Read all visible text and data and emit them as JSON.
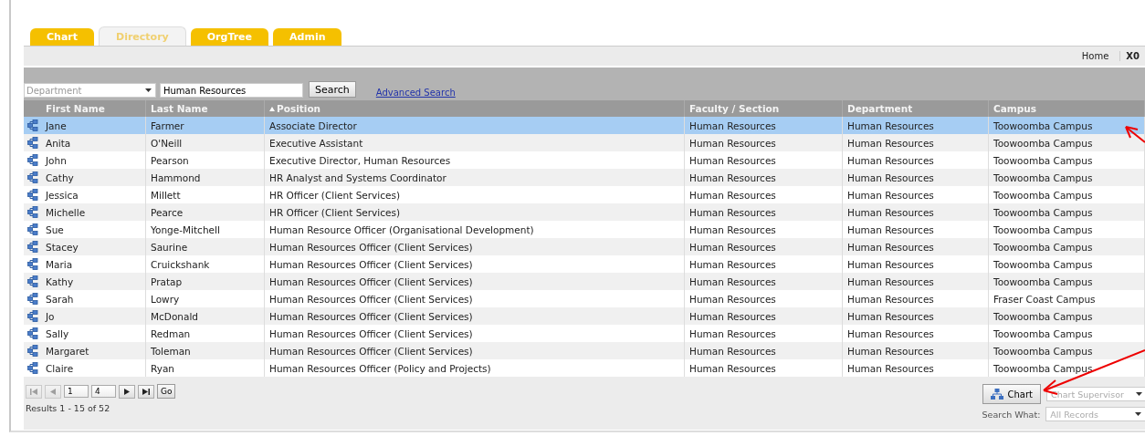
{
  "tabs": [
    {
      "label": "Chart",
      "selected": false
    },
    {
      "label": "Directory",
      "selected": true
    },
    {
      "label": "OrgTree",
      "selected": false
    },
    {
      "label": "Admin",
      "selected": false
    }
  ],
  "toolbar": {
    "links": [
      "Home",
      "X0"
    ]
  },
  "search": {
    "field_select": "Department",
    "query": "Human Resources",
    "button": "Search",
    "advanced_link": "Advanced Search"
  },
  "table": {
    "columns": [
      {
        "label": "First Name",
        "sorted": false
      },
      {
        "label": "Last Name",
        "sorted": false
      },
      {
        "label": "Position",
        "sorted": true
      },
      {
        "label": "Faculty / Section",
        "sorted": false
      },
      {
        "label": "Department",
        "sorted": false
      },
      {
        "label": "Campus",
        "sorted": false
      }
    ],
    "rows": [
      {
        "cells": [
          "Jane",
          "Farmer",
          "Associate Director",
          "Human Resources",
          "Human Resources",
          "Toowoomba Campus"
        ],
        "selected": true
      },
      {
        "cells": [
          "Anita",
          "O'Neill",
          "Executive Assistant",
          "Human Resources",
          "Human Resources",
          "Toowoomba Campus"
        ],
        "selected": false
      },
      {
        "cells": [
          "John",
          "Pearson",
          "Executive Director, Human Resources",
          "Human Resources",
          "Human Resources",
          "Toowoomba Campus"
        ],
        "selected": false
      },
      {
        "cells": [
          "Cathy",
          "Hammond",
          "HR Analyst and Systems Coordinator",
          "Human Resources",
          "Human Resources",
          "Toowoomba Campus"
        ],
        "selected": false
      },
      {
        "cells": [
          "Jessica",
          "Millett",
          "HR Officer (Client Services)",
          "Human Resources",
          "Human Resources",
          "Toowoomba Campus"
        ],
        "selected": false
      },
      {
        "cells": [
          "Michelle",
          "Pearce",
          "HR Officer (Client Services)",
          "Human Resources",
          "Human Resources",
          "Toowoomba Campus"
        ],
        "selected": false
      },
      {
        "cells": [
          "Sue",
          "Yonge-Mitchell",
          "Human Resource Officer (Organisational Development)",
          "Human Resources",
          "Human Resources",
          "Toowoomba Campus"
        ],
        "selected": false
      },
      {
        "cells": [
          "Stacey",
          "Saurine",
          "Human Resources Officer (Client Services)",
          "Human Resources",
          "Human Resources",
          "Toowoomba Campus"
        ],
        "selected": false
      },
      {
        "cells": [
          "Maria",
          "Cruickshank",
          "Human Resources Officer (Client Services)",
          "Human Resources",
          "Human Resources",
          "Toowoomba Campus"
        ],
        "selected": false
      },
      {
        "cells": [
          "Kathy",
          "Pratap",
          "Human Resources Officer (Client Services)",
          "Human Resources",
          "Human Resources",
          "Toowoomba Campus"
        ],
        "selected": false
      },
      {
        "cells": [
          "Sarah",
          "Lowry",
          "Human Resources Officer (Client Services)",
          "Human Resources",
          "Human Resources",
          "Fraser Coast Campus"
        ],
        "selected": false
      },
      {
        "cells": [
          "Jo",
          "McDonald",
          "Human Resources Officer (Client Services)",
          "Human Resources",
          "Human Resources",
          "Toowoomba Campus"
        ],
        "selected": false
      },
      {
        "cells": [
          "Sally",
          "Redman",
          "Human Resources Officer (Client Services)",
          "Human Resources",
          "Human Resources",
          "Toowoomba Campus"
        ],
        "selected": false
      },
      {
        "cells": [
          "Margaret",
          "Toleman",
          "Human Resources Officer (Client Services)",
          "Human Resources",
          "Human Resources",
          "Toowoomba Campus"
        ],
        "selected": false
      },
      {
        "cells": [
          "Claire",
          "Ryan",
          "Human Resources Officer (Policy and Projects)",
          "Human Resources",
          "Human Resources",
          "Toowoomba Campus"
        ],
        "selected": false
      }
    ]
  },
  "pager": {
    "page": "1",
    "pages": "4",
    "go": "Go",
    "results": "Results 1 - 15 of 52"
  },
  "chart_panel": {
    "button": "Chart",
    "supervisor_placeholder": "Chart Supervisor",
    "search_what_label": "Search What:",
    "search_what_value": "All Records"
  }
}
